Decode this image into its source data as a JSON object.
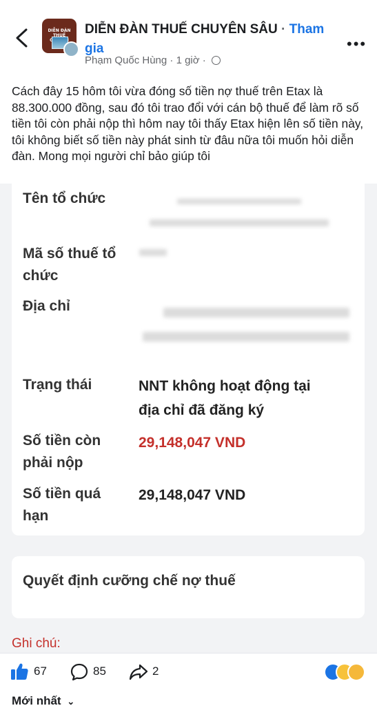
{
  "header": {
    "group_name": "DIỄN ĐÀN THUẾ CHUYÊN SÂU",
    "separator": "·",
    "join_label": "Tham gia",
    "author": "Phạm Quốc Hùng",
    "time": "1 giờ",
    "avatar_text": "DIỄN ĐÀN THUẾ CHUYÊN"
  },
  "post": {
    "text": "Cách đây 15 hôm tôi vừa đóng số tiền nợ thuế trên Etax là 88.300.000 đồng, sau đó tôi trao đổi với cán bộ thuế để làm rõ số tiền tôi còn phải nộp thì hôm nay tôi thấy Etax hiện lên số tiền này, tôi không biết số tiền này phát sinh từ đâu nữa tôi muốn hỏi diễn đàn. Mong mọi người chỉ bảo giúp tôi"
  },
  "screenshot": {
    "org_name_label": "Tên tổ chức",
    "tax_code_label_1": "Mã số thuế tổ",
    "tax_code_label_2": "chức",
    "address_label": "Địa chỉ",
    "status_label": "Trạng thái",
    "status_value_1": "NNT không hoạt động tại",
    "status_value_2": "địa chỉ đã đăng ký",
    "remaining_label_1": "Số tiền còn",
    "remaining_label_2": "phải nộp",
    "remaining_value": "29,148,047 VND",
    "overdue_label_1": "Số tiền quá",
    "overdue_label_2": "hạn",
    "overdue_value": "29,148,047 VND",
    "decision_title": "Quyết định cưỡng chế nợ thuế",
    "note_label": "Ghi chú:",
    "accent_red": "#c4302b"
  },
  "actions": {
    "likes": "67",
    "comments": "85",
    "shares": "2"
  },
  "sort_label": "Mới nhất"
}
